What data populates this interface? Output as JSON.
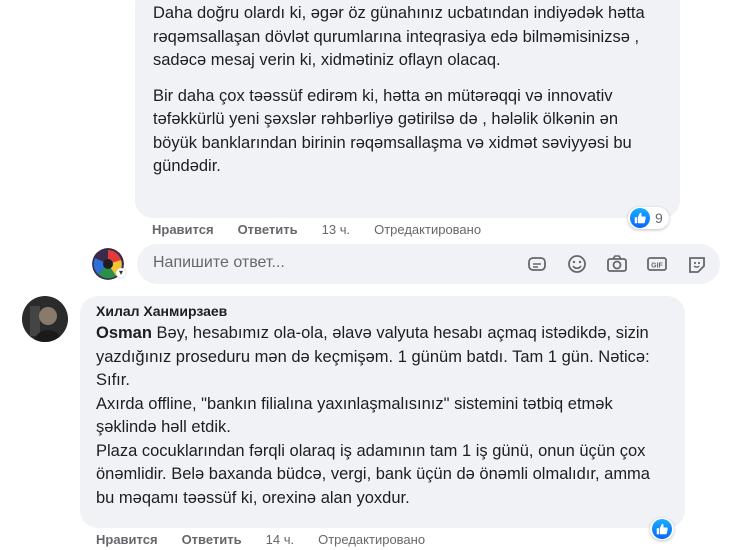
{
  "comment1": {
    "paragraph1": "Daha doğru olardı ki, əgər öz günahınız ucbatından indiyədək hətta rəqəmsallaşan dövlət qurumlarına inteqrasiya edə bilməmisinizsə , sadəcə mesaj verin ki, xidmətiniz oflayn olacaq.",
    "paragraph2": "Bir daha çox təəssüf edirəm ki, hətta ən mütərəqqi və innovativ təfəkkürlü yeni şəxslər rəhbərliyə gətirilsə də , hələlik ölkənin ən böyük banklarından birinin rəqəmsallaşma və xidmət səviyyəsi bu gündədir.",
    "actions": {
      "like": "Нравится",
      "reply": "Ответить",
      "time": "13 ч.",
      "edited": "Отредактировано"
    },
    "reaction_count": "9"
  },
  "reply_box": {
    "placeholder": "Напишите ответ..."
  },
  "comment2": {
    "author": "Хилал Ханмирзаев",
    "mention": "Osman",
    "line1_rest": " Bəy, hesabımız ola-ola, əlavə valyuta hesabı açmaq istədikdə, sizin yazdığınız proseduru mən də keçmişəm. 1 günüm batdı. Tam 1 gün. Nəticə: Sıfır.",
    "line2": "Axırda offline, \"bankın filialına yaxınlaşmalısınız\" sistemini tətbiq etmək şəklində həll etdik.",
    "line3": "Plaza cocuklarından fərqli olaraq iş adamının tam 1 iş günü, onun üçün çox önəmlidir. Belə baxanda büdcə, vergi, bank üçün də önəmli olmalıdır, amma bu məqamı təəssüf ki, orexinə alan yoxdur.",
    "actions": {
      "like": "Нравится",
      "reply": "Ответить",
      "time": "14 ч.",
      "edited": "Отредактировано"
    }
  },
  "colors": {
    "bubble_bg": "#f0f2f5",
    "secondary_text": "#65676b",
    "like_blue": "#0866ff"
  },
  "icons": [
    "like-reaction-icon",
    "sticker-icon",
    "emoji-icon",
    "camera-icon",
    "gif-icon",
    "smile-sticker-icon"
  ]
}
